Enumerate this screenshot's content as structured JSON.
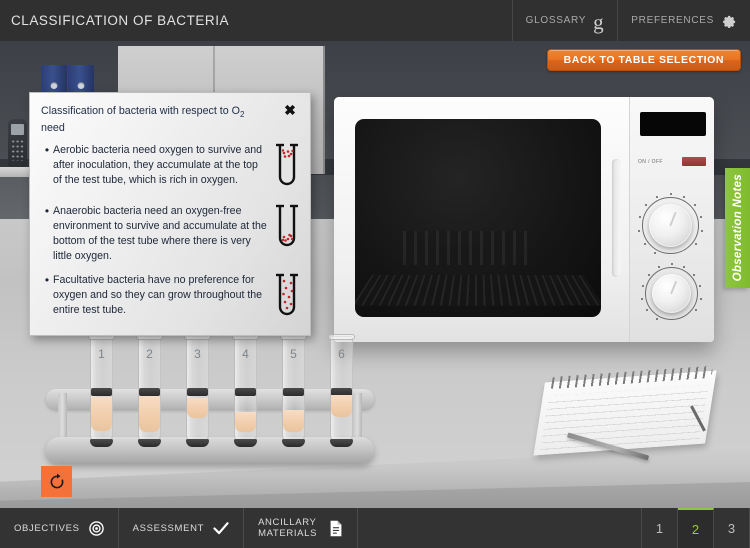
{
  "header": {
    "title": "CLASSIFICATION OF BACTERIA",
    "glossary_label": "GLOSSARY",
    "glossary_icon": "g-letter-icon",
    "preferences_label": "PREFERENCES",
    "preferences_icon": "gear-icon"
  },
  "actions": {
    "back_to_table": "BACK TO TABLE SELECTION",
    "reset_icon": "reset-circular-arrow-icon",
    "observation_notes": "Observation Notes"
  },
  "info_panel": {
    "title_prefix": "Classification of bacteria with respect to O",
    "title_sub": "2",
    "title_suffix": " need",
    "close_icon": "close-icon",
    "bullets": [
      {
        "text": "Aerobic bacteria need oxygen to survive and after inoculation, they accumulate at the top of the test tube, which is rich in oxygen.",
        "icon": "test-tube-bacteria-top-icon"
      },
      {
        "text": "Anaerobic bacteria need an oxygen-free environment to survive and accumulate at the bottom of the test tube where there is very little oxygen.",
        "icon": "test-tube-bacteria-bottom-icon"
      },
      {
        "text": "Facultative bacteria have no preference for oxygen and so they can grow throughout the entire test tube.",
        "icon": "test-tube-bacteria-throughout-icon"
      }
    ]
  },
  "scene": {
    "test_tubes": [
      {
        "label": "1"
      },
      {
        "label": "2"
      },
      {
        "label": "3"
      },
      {
        "label": "4"
      },
      {
        "label": "5"
      },
      {
        "label": "6"
      }
    ],
    "oven_onoff_label": "ON / OFF"
  },
  "footer": {
    "items": [
      {
        "label": "OBJECTIVES",
        "icon": "target-icon"
      },
      {
        "label": "ASSESSMENT",
        "icon": "checkmark-icon"
      },
      {
        "label": "ANCILLARY MATERIALS",
        "icon": "document-icon"
      }
    ],
    "pages": [
      {
        "label": "1",
        "active": false
      },
      {
        "label": "2",
        "active": true
      },
      {
        "label": "3",
        "active": false
      }
    ]
  },
  "colors": {
    "accent_orange": "#ea7421",
    "accent_green": "#8dc63f",
    "bar_dark": "#303030",
    "footer_dark": "#333333"
  }
}
